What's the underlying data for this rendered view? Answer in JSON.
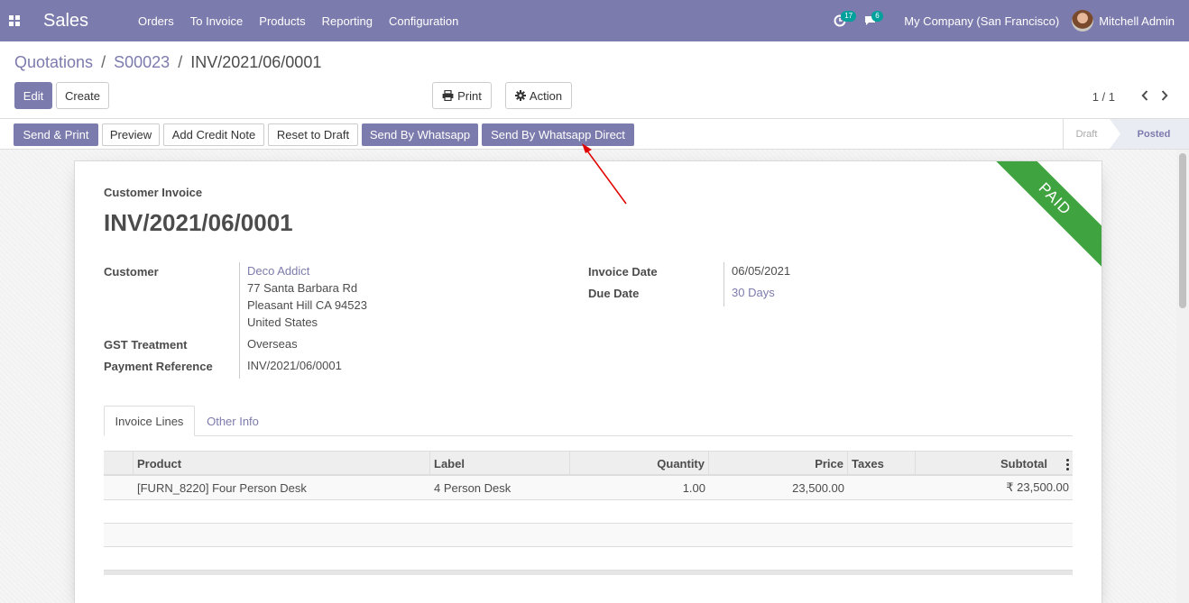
{
  "navbar": {
    "app_name": "Sales",
    "menu": [
      "Orders",
      "To Invoice",
      "Products",
      "Reporting",
      "Configuration"
    ],
    "activity_count": "17",
    "message_count": "6",
    "company": "My Company (San Francisco)",
    "user": "Mitchell Admin",
    "color": "#7c7bad"
  },
  "breadcrumb": {
    "items": [
      "Quotations",
      "S00023"
    ],
    "current": "INV/2021/06/0001",
    "separator": "/"
  },
  "control": {
    "edit": "Edit",
    "create": "Create",
    "print": "Print",
    "action": "Action",
    "pager": "1 / 1"
  },
  "statusbar": {
    "buttons": [
      "Send & Print",
      "Preview",
      "Add Credit Note",
      "Reset to Draft",
      "Send By Whatsapp",
      "Send By Whatsapp Direct"
    ],
    "stages": [
      "Draft",
      "Posted"
    ],
    "active_stage": "Posted"
  },
  "invoice": {
    "type_label": "Customer Invoice",
    "number": "INV/2021/06/0001",
    "ribbon": "PAID",
    "customer_label": "Customer",
    "customer_name": "Deco Addict",
    "address_line1": "77 Santa Barbara Rd",
    "address_line2": "Pleasant Hill CA 94523",
    "address_line3": "United States",
    "gst_label": "GST Treatment",
    "gst_value": "Overseas",
    "payref_label": "Payment Reference",
    "payref_value": "INV/2021/06/0001",
    "invoice_date_label": "Invoice Date",
    "invoice_date": "06/05/2021",
    "due_date_label": "Due Date",
    "due_date": "30 Days"
  },
  "tabs": [
    "Invoice Lines",
    "Other Info"
  ],
  "lines": {
    "columns": [
      "Product",
      "Label",
      "Quantity",
      "Price",
      "Taxes",
      "Subtotal"
    ],
    "rows": [
      {
        "product": "[FURN_8220] Four Person Desk",
        "label": "4 Person Desk",
        "quantity": "1.00",
        "price": "23,500.00",
        "taxes": "",
        "subtotal": "₹ 23,500.00"
      }
    ]
  }
}
